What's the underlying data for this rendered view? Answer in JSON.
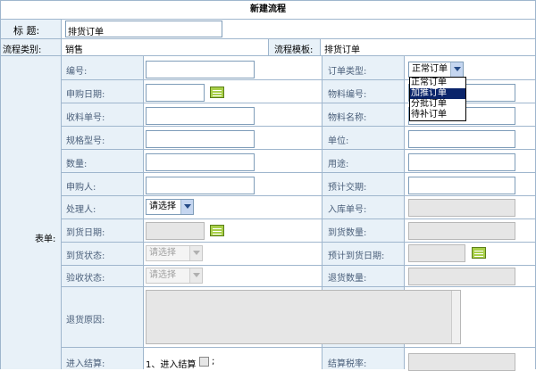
{
  "window": {
    "title": "新建流程"
  },
  "header": {
    "subject_label": "标  题:",
    "subject_value": "排货订单",
    "category_label": "流程类别:",
    "category_value": "销售",
    "template_label": "流程模板:",
    "template_value": "排货订单"
  },
  "form": {
    "side_label": "表单:",
    "fields": {
      "code": "编号:",
      "order_type": "订单类型:",
      "apply_date": "申购日期:",
      "material_code": "物料编号:",
      "receipt_no": "收料单号:",
      "material_name": "物料名称:",
      "spec_model": "规格型号:",
      "unit": "单位:",
      "quantity": "数量:",
      "purpose": "用途:",
      "applicant": "申购人:",
      "expected_delivery": "预计交期:",
      "handler": "处理人:",
      "stockin_no": "入库单号:",
      "arrival_date": "到货日期:",
      "arrival_qty": "到货数量:",
      "arrival_status": "到货状态:",
      "expected_arrival_date": "预计到货日期:",
      "inspection_status": "验收状态:",
      "return_qty": "退货数量:",
      "return_reason": "退货原因:",
      "enter_settlement": "进入结算:",
      "settlement_tax": "结算税率:"
    },
    "order_type_select": {
      "value": "正常订单",
      "options": [
        "正常订单",
        "加推订单",
        "分批订单",
        "待补订单"
      ],
      "highlighted": "加推订单"
    },
    "handler_select": "请选择",
    "arrival_status_select": "请选择",
    "inspection_status_select": "请选择",
    "settlement_check_label": "1、进入结算",
    "settlement_suffix": ";"
  },
  "colors": {
    "border": "#9fb6cd",
    "label_bg": "#e8f1f8",
    "label_text": "#4a5f7a",
    "highlight": "#0a246a",
    "calendar": "#a8cf49"
  }
}
